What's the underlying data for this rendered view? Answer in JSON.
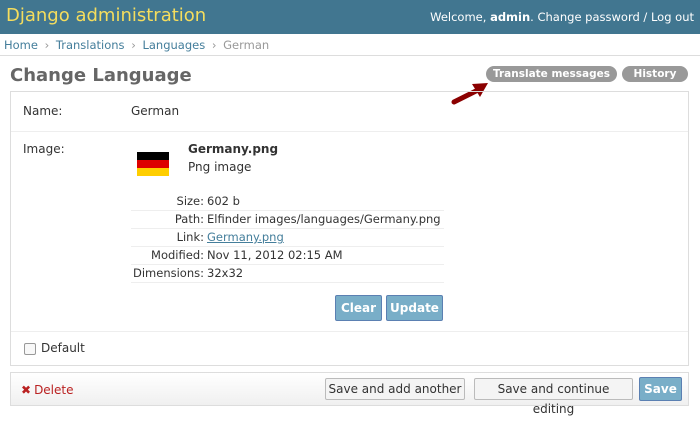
{
  "header": {
    "branding": "Django administration",
    "welcome": "Welcome,",
    "username": "admin",
    "change_password": "Change password",
    "sep": " / ",
    "logout": "Log out"
  },
  "breadcrumbs": {
    "items": [
      "Home",
      "Translations",
      "Languages"
    ],
    "current": "German",
    "sep": "›"
  },
  "page": {
    "title": "Change Language",
    "tools": {
      "translate": "Translate messages",
      "history": "History"
    }
  },
  "form": {
    "name_label": "Name:",
    "name_value": "German",
    "image_label": "Image:",
    "file_title": "Germany.png",
    "file_type": "Png image",
    "meta": [
      {
        "key": "Size:",
        "value": "602 b"
      },
      {
        "key": "Path:",
        "value": "Elfinder images/languages/Germany.png"
      },
      {
        "key": "Link:",
        "value": "Germany.png"
      },
      {
        "key": "Modified:",
        "value": "Nov 11, 2012 02:15 AM"
      },
      {
        "key": "Dimensions:",
        "value": "32x32"
      }
    ],
    "clear": "Clear",
    "update": "Update",
    "default_label": "Default",
    "default_checked": false
  },
  "submit": {
    "delete": "Delete",
    "save_add": "Save and add another",
    "save_continue": "Save and continue editing",
    "save": "Save"
  },
  "colors": {
    "header_bg": "#417690",
    "branding": "#f5dd5d",
    "link": "#447e9b",
    "button_blue": "#79aec8",
    "delete_red": "#ba2121",
    "arrow": "#8b0000",
    "flag": [
      "#000000",
      "#dd0000",
      "#ffce00"
    ]
  }
}
